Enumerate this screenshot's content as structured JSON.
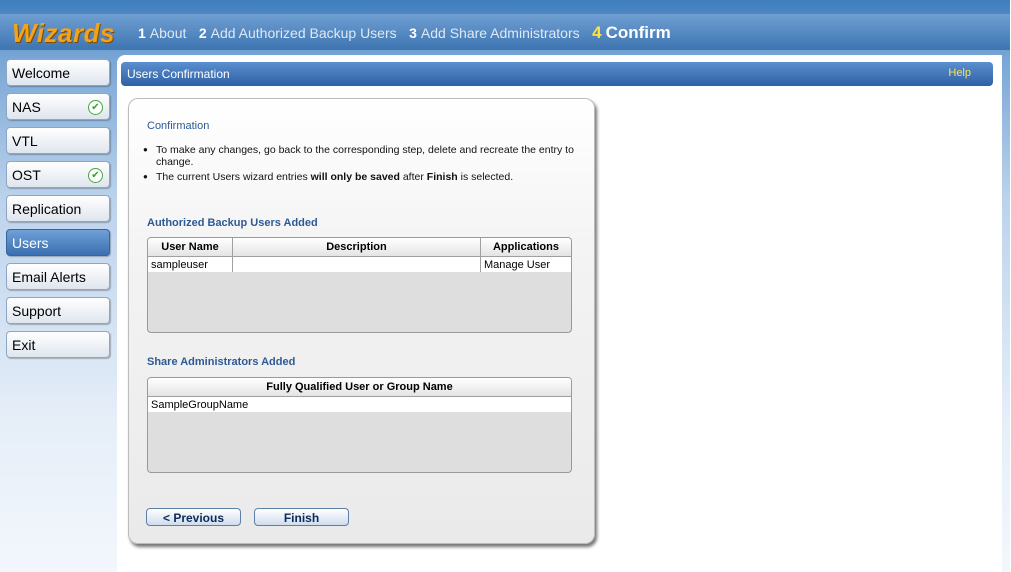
{
  "wizard": {
    "logo": "Wizards",
    "steps": [
      {
        "num": "1",
        "label": "About",
        "active": false
      },
      {
        "num": "2",
        "label": "Add Authorized Backup Users",
        "active": false
      },
      {
        "num": "3",
        "label": "Add Share Administrators",
        "active": false
      },
      {
        "num": "4",
        "label": "Confirm",
        "active": true
      }
    ]
  },
  "sidebar": {
    "items": [
      {
        "label": "Welcome",
        "checked": false,
        "active": false
      },
      {
        "label": "NAS",
        "checked": true,
        "active": false
      },
      {
        "label": "VTL",
        "checked": false,
        "active": false
      },
      {
        "label": "OST",
        "checked": true,
        "active": false
      },
      {
        "label": "Replication",
        "checked": false,
        "active": false
      },
      {
        "label": "Users",
        "checked": false,
        "active": true
      },
      {
        "label": "Email Alerts",
        "checked": false,
        "active": false
      },
      {
        "label": "Support",
        "checked": false,
        "active": false
      },
      {
        "label": "Exit",
        "checked": false,
        "active": false
      }
    ]
  },
  "header": {
    "title": "Users Confirmation",
    "help": "Help"
  },
  "confirmation": {
    "heading": "Confirmation",
    "bullet1": "To make any changes, go back to the corresponding step, delete and recreate the entry to change.",
    "bullet2_a": "The current Users wizard entries ",
    "bullet2_b": "will only be saved",
    "bullet2_c": " after ",
    "bullet2_d": "Finish",
    "bullet2_e": " is selected."
  },
  "backup_users": {
    "heading": "Authorized Backup Users Added",
    "columns": [
      "User Name",
      "Description",
      "Applications"
    ],
    "rows": [
      {
        "user": "sampleuser",
        "description": "",
        "applications": "Manage User"
      }
    ]
  },
  "share_admins": {
    "heading": "Share Administrators Added",
    "column": "Fully Qualified User or Group Name",
    "rows": [
      {
        "name": "SampleGroupName"
      }
    ]
  },
  "buttons": {
    "previous": "< Previous",
    "finish": "Finish"
  },
  "colors": {
    "accent_blue": "#3d75b2",
    "logo_orange": "#f4a21a",
    "help_yellow": "#ffe24a",
    "check_green": "#36a12d"
  }
}
